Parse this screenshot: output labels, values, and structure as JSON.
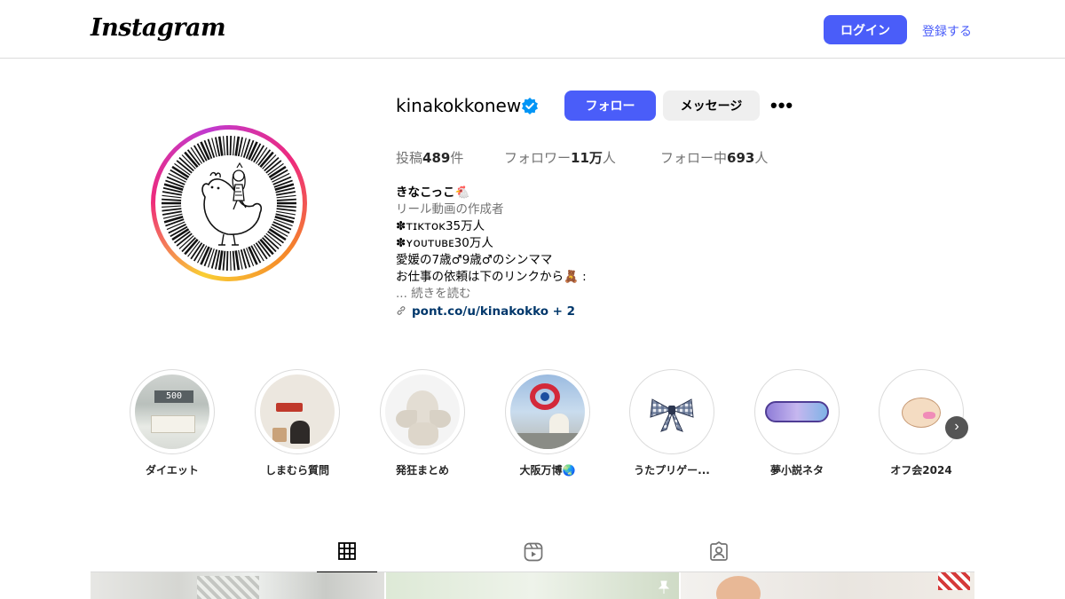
{
  "header": {
    "logo": "Instagram",
    "login_label": "ログイン",
    "signup_label": "登録する"
  },
  "profile": {
    "username": "kinakokkonew",
    "verified": true,
    "follow_label": "フォロー",
    "message_label": "メッセージ",
    "more_label": "•••",
    "stats": {
      "posts_prefix": "投稿",
      "posts_value": "489",
      "posts_suffix": "件",
      "followers_prefix": "フォロワー",
      "followers_value": "11万",
      "followers_suffix": "人",
      "following_prefix": "フォロー中",
      "following_value": "693",
      "following_suffix": "人"
    },
    "bio": {
      "name": "きなこっこ🐔",
      "category": "リール動画の作成者",
      "lines": [
        "✽ᴛɪᴋᴛᴏᴋ35万人",
        "✽ʏᴏᴜᴛᴜʙᴇ30万人",
        "愛媛の7歳♂9歳♂のシンママ",
        "お仕事の依頼は下のリンクから🧸 :"
      ],
      "more": "... 続きを読む",
      "link": "pont.co/u/kinakokko + 2"
    }
  },
  "highlights": [
    {
      "label": "ダイエット"
    },
    {
      "label": "しまむら質問"
    },
    {
      "label": "発狂まとめ"
    },
    {
      "label": "大阪万博🌏"
    },
    {
      "label": "うたプリゲー..."
    },
    {
      "label": "夢小説ネタ"
    },
    {
      "label": "オフ会2024"
    }
  ],
  "highlight_next_icon": "chevron-right-icon",
  "tabs": [
    {
      "name": "posts",
      "icon": "grid-icon",
      "active": true
    },
    {
      "name": "reels",
      "icon": "reels-icon",
      "active": false
    },
    {
      "name": "tagged",
      "icon": "tagged-icon",
      "active": false
    }
  ],
  "colors": {
    "accent": "#4a5df9",
    "link": "#00376b",
    "muted": "#737373",
    "border": "#dbdbdb"
  }
}
